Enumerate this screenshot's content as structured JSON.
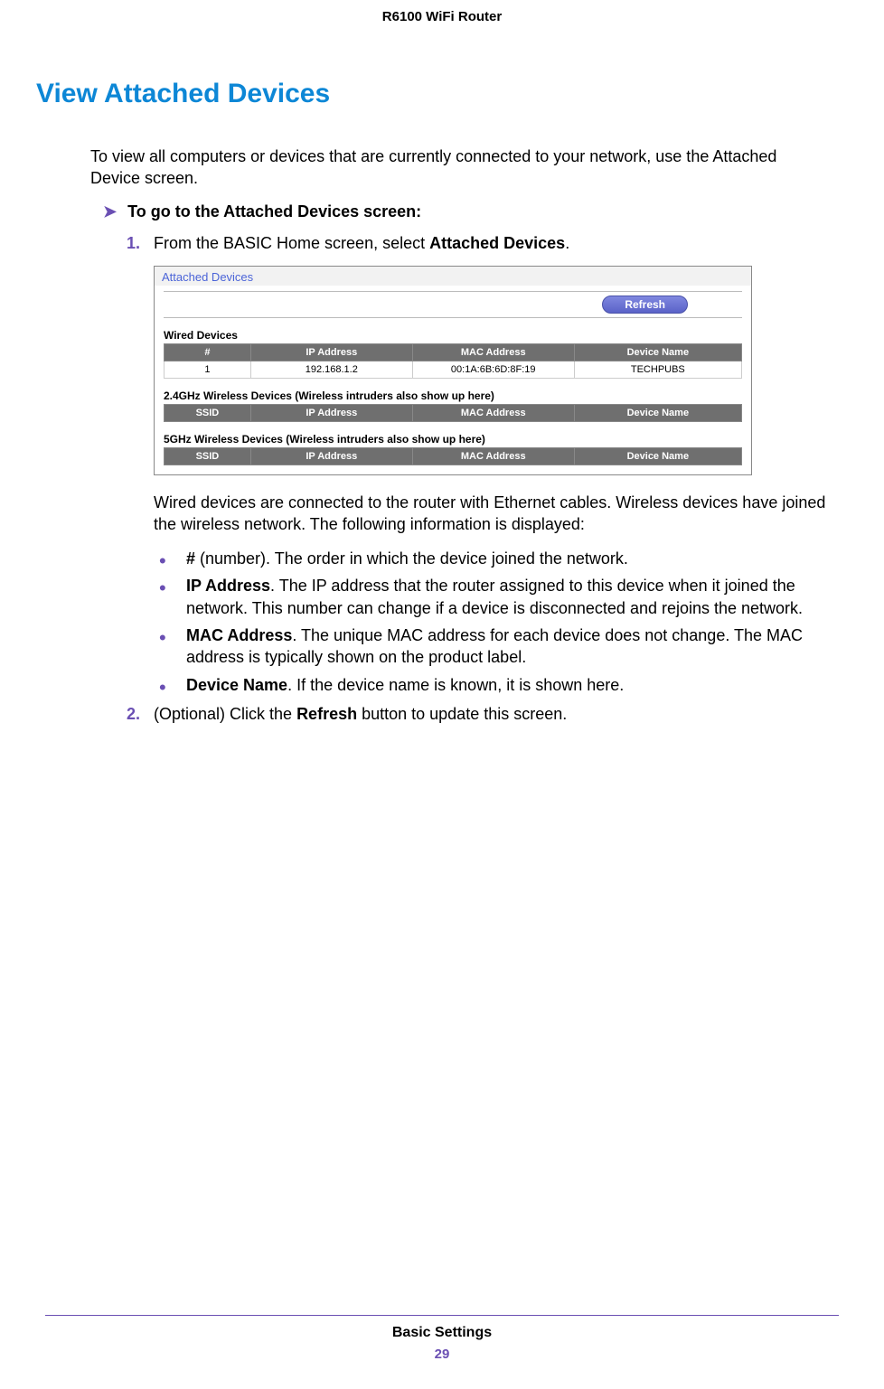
{
  "doc": {
    "header": "R6100 WiFi Router",
    "footer_title": "Basic Settings",
    "page_number": "29"
  },
  "section": {
    "title": "View Attached Devices",
    "intro": "To view all computers or devices that are currently connected to your network, use the Attached Device screen.",
    "task": "To go to the Attached Devices screen:",
    "step1_pre": "From the BASIC Home screen, select ",
    "step1_bold": "Attached Devices",
    "step1_post": ".",
    "num1": "1.",
    "num2": "2.",
    "after_shot": "Wired devices are connected to the router with Ethernet cables. Wireless devices have joined the wireless network. The following information is displayed:",
    "b1_bold": "#",
    "b1_rest": " (number). The order in which the device joined the network.",
    "b2_bold": "IP Address",
    "b2_rest": ". The IP address that the router assigned to this device when it joined the network. This number can change if a device is disconnected and rejoins the network.",
    "b3_bold": "MAC Address",
    "b3_rest": ". The unique MAC address for each device does not change. The MAC address is typically shown on the product label.",
    "b4_bold": "Device Name",
    "b4_rest": ". If the device name is known, it is shown here.",
    "step2_pre": "(Optional) Click the ",
    "step2_bold": "Refresh",
    "step2_post": " button to update this screen."
  },
  "screenshot": {
    "title": "Attached Devices",
    "refresh_label": "Refresh",
    "wired_caption": "Wired Devices",
    "g24_caption": "2.4GHz Wireless Devices (Wireless intruders also show up here)",
    "g5_caption": "5GHz Wireless Devices (Wireless intruders also show up here)",
    "headers_wired": [
      "#",
      "IP Address",
      "MAC Address",
      "Device Name"
    ],
    "headers_wireless": [
      "SSID",
      "IP Address",
      "MAC Address",
      "Device Name"
    ],
    "wired_row": [
      "1",
      "192.168.1.2",
      "00:1A:6B:6D:8F:19",
      "TECHPUBS"
    ]
  }
}
